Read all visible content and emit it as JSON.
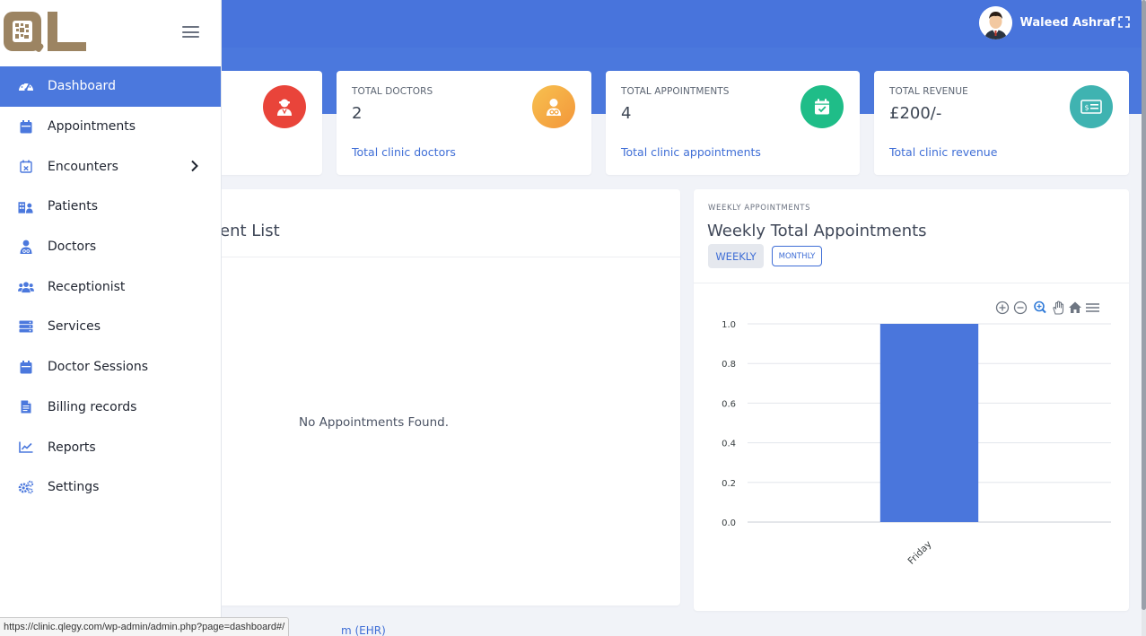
{
  "header": {
    "user_name": "Waleed Ashraf"
  },
  "colors": {
    "accent": "#4b78dd",
    "link": "#3f6ed6",
    "patients_icon": "#e9443a",
    "doctors_icon": "#f6a93b",
    "appointments_icon": "#1fbd88",
    "revenue_icon": "#3fb3b1"
  },
  "sidebar": {
    "logo_text": "QL",
    "items": [
      {
        "label": "Dashboard",
        "icon": "dashboard-gauge-icon",
        "active": true
      },
      {
        "label": "Appointments",
        "icon": "calendar-icon"
      },
      {
        "label": "Encounters",
        "icon": "calendar-x-icon",
        "has_submenu": true
      },
      {
        "label": "Patients",
        "icon": "patients-building-icon"
      },
      {
        "label": "Doctors",
        "icon": "doctor-icon"
      },
      {
        "label": "Receptionist",
        "icon": "users-group-icon"
      },
      {
        "label": "Services",
        "icon": "server-stack-icon"
      },
      {
        "label": "Doctor Sessions",
        "icon": "calendar-icon"
      },
      {
        "label": "Billing records",
        "icon": "file-invoice-icon"
      },
      {
        "label": "Reports",
        "icon": "line-chart-icon"
      },
      {
        "label": "Settings",
        "icon": "gears-icon"
      }
    ]
  },
  "stats": {
    "doctors": {
      "label": "TOTAL DOCTORS",
      "value": "2",
      "sub": "Total clinic doctors",
      "icon": "doctor-icon"
    },
    "appointments": {
      "label": "TOTAL APPOINTMENTS",
      "value": "4",
      "sub": "Total clinic appointments",
      "icon": "calendar-check-icon"
    },
    "revenue": {
      "label": "TOTAL REVENUE",
      "value": "£200/-",
      "sub": "Total clinic revenue",
      "icon": "money-bill-icon"
    }
  },
  "appointment_panel": {
    "title_fragment": "ent List",
    "empty_message": "No Appointments Found."
  },
  "weekly_panel": {
    "kicker": "WEEKLY APPOINTMENTS",
    "title": "Weekly Total Appointments",
    "tabs": [
      {
        "label": "WEEKLY",
        "active": true
      },
      {
        "label": "MONTHLY"
      }
    ],
    "toolbar_icons": [
      "zoom-in-icon",
      "zoom-out-icon",
      "selection-zoom-icon",
      "pan-hand-icon",
      "home-reset-icon",
      "menu-icon"
    ]
  },
  "chart_data": {
    "type": "bar",
    "categories": [
      "Friday"
    ],
    "values": [
      1
    ],
    "ylim": [
      0,
      1
    ],
    "yticks": [
      "0.0",
      "0.2",
      "0.4",
      "0.6",
      "0.8",
      "1.0"
    ],
    "bar_color": "#4a76dc",
    "grid": true,
    "legend": "none"
  },
  "footer": {
    "fragment": "m (EHR)"
  },
  "statusbar": {
    "url": "https://clinic.qlegy.com/wp-admin/admin.php?page=dashboard#/"
  }
}
